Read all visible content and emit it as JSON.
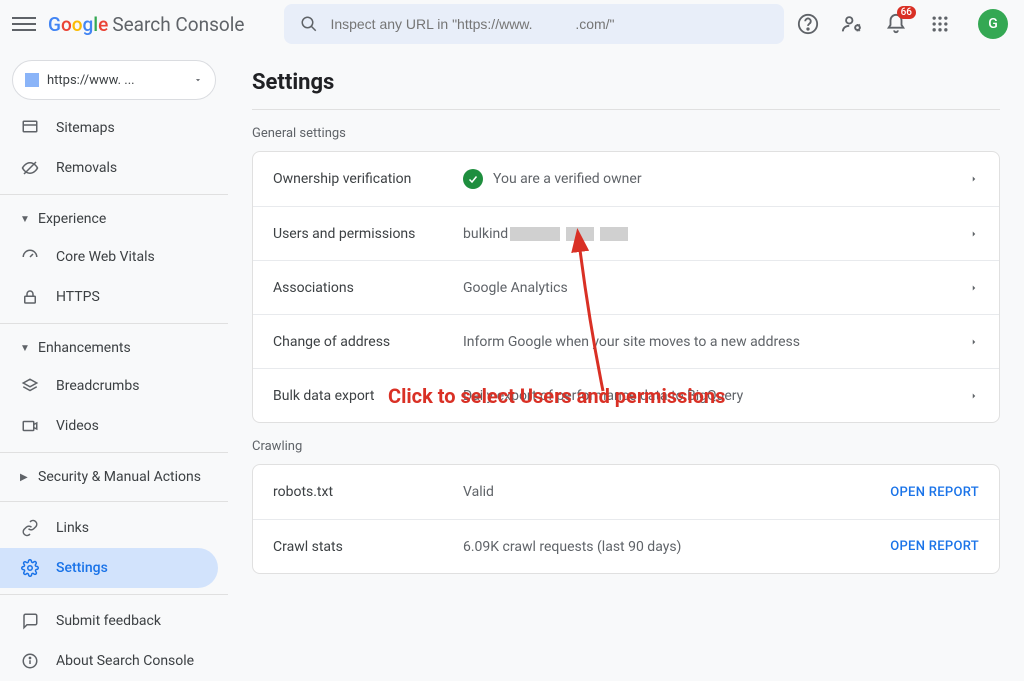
{
  "header": {
    "product": "Search Console",
    "search_placeholder": "Inspect any URL in \"https://www.           .com/\"",
    "notif_count": "66",
    "avatar_initial": "G"
  },
  "property": {
    "url_masked": "https://www.          ..."
  },
  "sidebar": {
    "sitemaps": "Sitemaps",
    "removals": "Removals",
    "experience": "Experience",
    "cwv": "Core Web Vitals",
    "https": "HTTPS",
    "enhancements": "Enhancements",
    "breadcrumbs": "Breadcrumbs",
    "videos": "Videos",
    "security": "Security & Manual Actions",
    "links": "Links",
    "settings": "Settings",
    "feedback": "Submit feedback",
    "about": "About Search Console"
  },
  "page": {
    "title": "Settings",
    "general_label": "General settings",
    "crawling_label": "Crawling",
    "open_report": "OPEN REPORT"
  },
  "rows": {
    "ownership": {
      "label": "Ownership verification",
      "value": "You are a verified owner"
    },
    "users": {
      "label": "Users and permissions",
      "value_prefix": "bulkind"
    },
    "assoc": {
      "label": "Associations",
      "value": "Google Analytics"
    },
    "coa": {
      "label": "Change of address",
      "value": "Inform Google when your site moves to a new address"
    },
    "bde": {
      "label": "Bulk data export",
      "value": "Daily export of performance data to BigQuery"
    },
    "robots": {
      "label": "robots.txt",
      "value": "Valid"
    },
    "crawl": {
      "label": "Crawl stats",
      "value": "6.09K crawl requests (last 90 days)"
    }
  },
  "annotation": {
    "text": "Click to select Users and permissions"
  }
}
